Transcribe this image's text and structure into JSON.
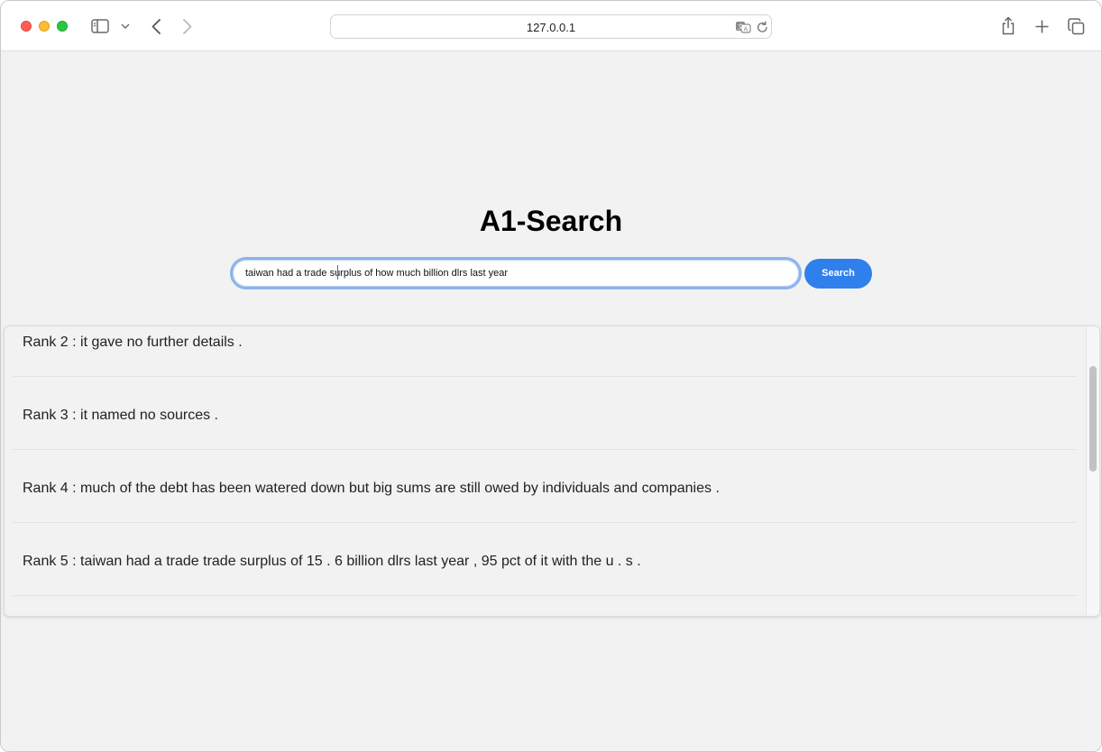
{
  "browser": {
    "url": "127.0.0.1"
  },
  "page": {
    "title": "A1-Search",
    "search": {
      "value": "taiwan had a trade surplus of how much billion dlrs last year",
      "button_label": "Search"
    },
    "results": [
      {
        "text": "Rank 2 : it gave no further details ."
      },
      {
        "text": "Rank 3 : it named no sources ."
      },
      {
        "text": "Rank 4 : much of the debt has been watered down but big sums are still owed by individuals and companies ."
      },
      {
        "text": "Rank 5 : taiwan had a trade trade surplus of 15 . 6 billion dlrs last year , 95 pct of it with the u . s ."
      }
    ]
  },
  "icons": {
    "sidebar": "sidebar-icon",
    "chevron": "chevron-down-icon",
    "back": "back-arrow-icon",
    "forward": "forward-arrow-icon",
    "translate": "translate-icon",
    "reload": "reload-icon",
    "share": "share-icon",
    "new_tab": "plus-icon",
    "tabs": "tabs-overview-icon"
  }
}
